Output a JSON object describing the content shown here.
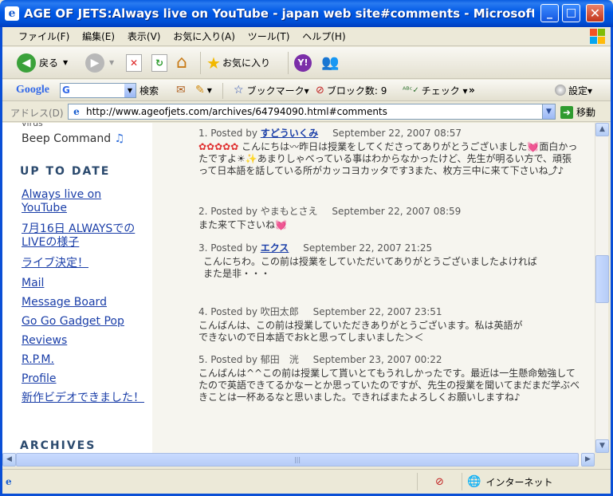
{
  "window": {
    "title": "AGE OF JETS:Always live on YouTube - japan web site#comments - Microsoft Int...",
    "min_label": "_",
    "max_label": "□",
    "close_label": "✕"
  },
  "menu": [
    "ファイル(F)",
    "編集(E)",
    "表示(V)",
    "お気に入り(A)",
    "ツール(T)",
    "ヘルプ(H)"
  ],
  "toolbar": {
    "back_label": "戻る",
    "favorites_label": "お気に入り"
  },
  "google_bar": {
    "logo": "Google",
    "search_label": "検索",
    "bookmark_label": "ブックマーク▾",
    "block_label": "ブロック数: 9",
    "check_label": "チェック ▾",
    "more_label": "»",
    "settings_label": "設定▾"
  },
  "address": {
    "label": "アドレス(D)",
    "url": "http://www.ageofjets.com/archives/64794090.html#comments",
    "go_label": "移動"
  },
  "sidebar": {
    "partial_top": "virus",
    "beep": "Beep Command",
    "up_to_date_heading": "UP TO DATE",
    "links": [
      "Always live on YouTube",
      "7月16日 ALWAYSでのLIVEの様子",
      "ライブ決定！",
      "Mail",
      "Message Board",
      "Go Go Gadget Pop",
      "Reviews",
      "R.P.M.",
      "Profile",
      "新作ビデオできました！"
    ],
    "archives_heading": "ARCHIVES"
  },
  "comments": [
    {
      "num": "1.",
      "posted_by": "Posted by",
      "author": "すどういくみ",
      "author_is_link": true,
      "date": "September 22, 2007 08:57",
      "body": "こんにちは〰昨日は授業をしてくださってありがとうございました💓面白かったですよ☀✨あまりしゃべっている事はわからなかったけど、先生が明るい方で、頑張って日本語を話している所がカッコヨカッタです3また、枚方三中に来て下さいね⤴♪",
      "prefix": "✿✿✿✿✿ "
    },
    {
      "num": "2.",
      "posted_by": "Posted by",
      "author": "やまもとさえ",
      "author_is_link": false,
      "date": "September 22, 2007 08:59",
      "body": "また来て下さいね💓"
    },
    {
      "num": "3.",
      "posted_by": "Posted by",
      "author": "エクス",
      "author_is_link": true,
      "date": "September 22, 2007 21:25",
      "body": "こんにちわ。この前は授業をしていただいてありがとうございましたよければまた是非・・・"
    },
    {
      "num": "4.",
      "posted_by": "Posted by",
      "author": "吹田太郎",
      "author_is_link": false,
      "date": "September 22, 2007 23:51",
      "body": "こんばんは、この前は授業していただきありがとうございます。私は英語ができないので日本語でおkと思ってしまいました＞＜"
    },
    {
      "num": "5.",
      "posted_by": "Posted by",
      "author": "郁田　洸",
      "author_is_link": false,
      "date": "September 23, 2007 00:22",
      "body": "こんばんは^^この前は授業して貰いとてもうれしかったです。最近は一生懸命勉強してたので英語できてるかなーとか思っていたのですが、先生の授業を聞いてまだまだ学ぶべきことは一杯あるなと思いました。できればまたよろしくお願いしますね♪"
    }
  ],
  "status": {
    "zone": "インターネット"
  }
}
